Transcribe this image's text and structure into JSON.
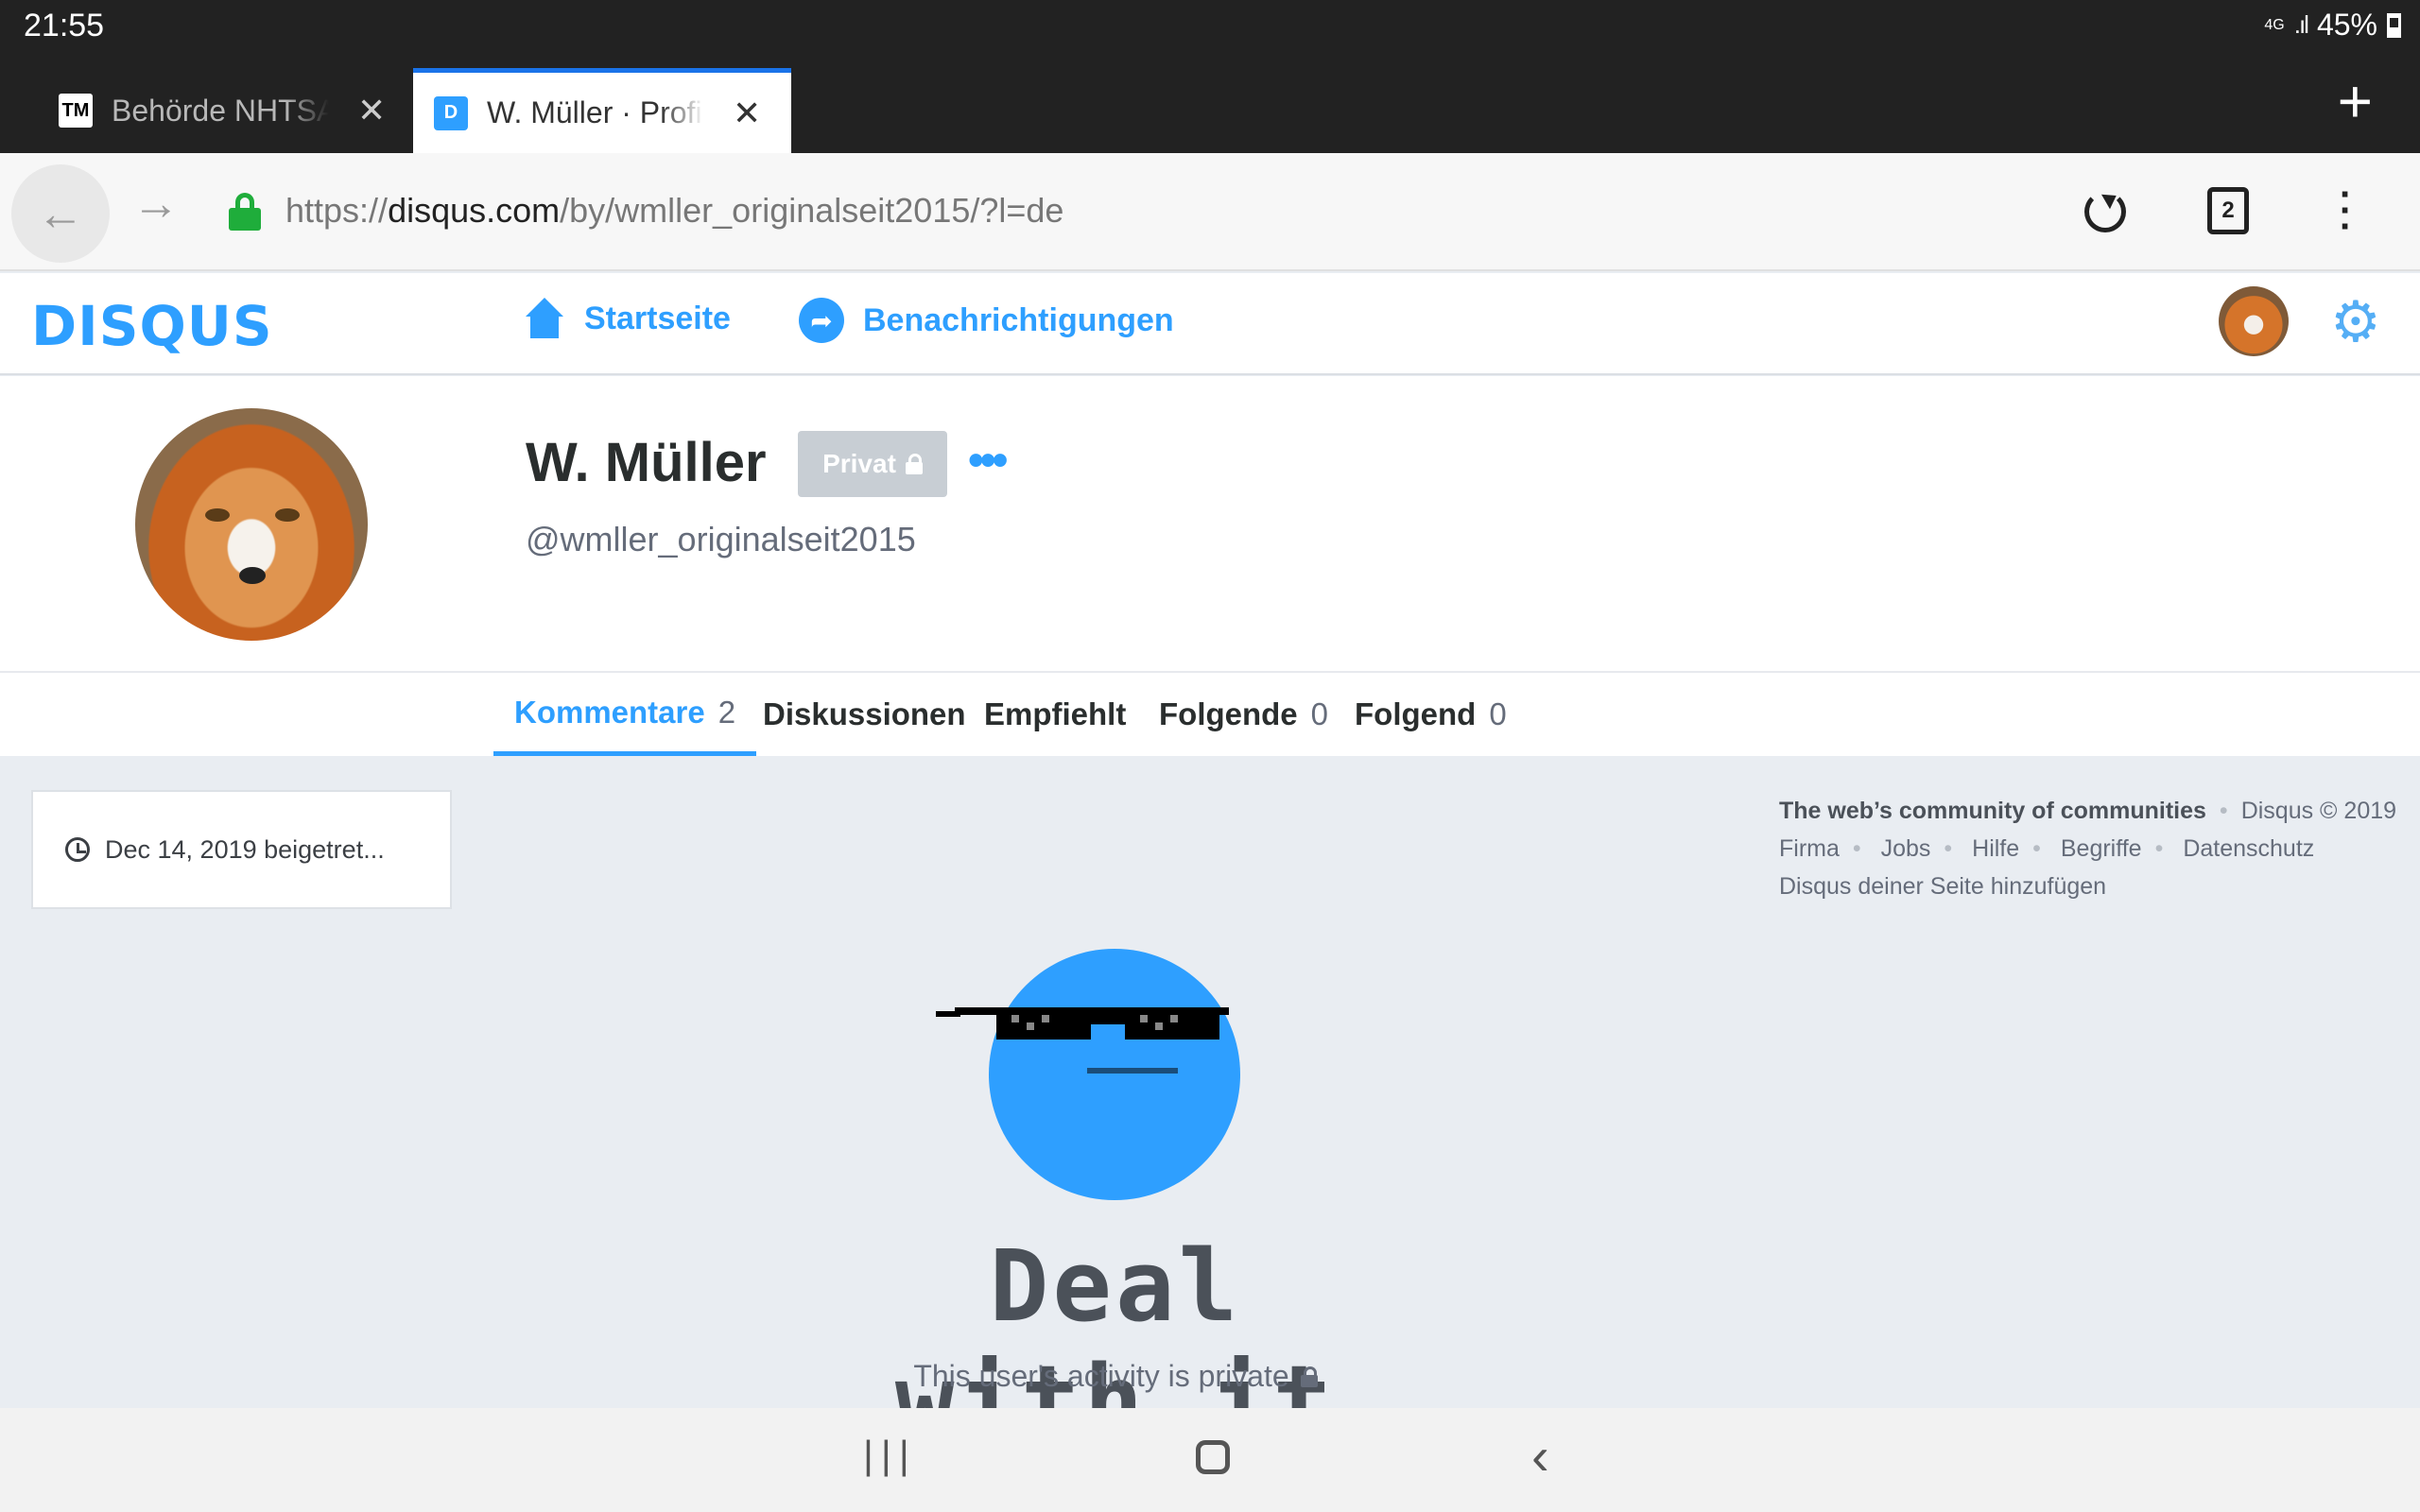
{
  "status_bar": {
    "time": "21:55",
    "network": "4G",
    "battery": "45%"
  },
  "browser": {
    "tabs": [
      {
        "title": "Behörde NHTSA",
        "favicon": "TM"
      },
      {
        "title": "W. Müller · Profil",
        "favicon": "D"
      }
    ],
    "url_prefix": "https://",
    "url_domain": "disqus.com",
    "url_path": "/by/wmller_originalseit2015/?l=de",
    "tab_count": "2"
  },
  "disqus_nav": {
    "logo": "DISQUS",
    "home_label": "Startseite",
    "notifications_label": "Benachrichtigungen"
  },
  "profile": {
    "name": "W. Müller",
    "privacy_badge": "Privat",
    "more_label": "•••",
    "handle": "@wmller_originalseit2015"
  },
  "profile_tabs": [
    {
      "label": "Kommentare",
      "count": "2"
    },
    {
      "label": "Diskussionen",
      "count": ""
    },
    {
      "label": "Empfiehlt",
      "count": ""
    },
    {
      "label": "Folgende",
      "count": "0"
    },
    {
      "label": "Folgend",
      "count": "0"
    }
  ],
  "joined": "Dec 14, 2019 beigetret...",
  "footer": {
    "tagline": "The web’s community of communities",
    "copyright": "Disqus © 2019",
    "links": [
      "Firma",
      "Jobs",
      "Hilfe",
      "Begriffe",
      "Datenschutz"
    ],
    "add_disqus": "Disqus deiner Seite hinzufügen"
  },
  "private_state": {
    "headline": "Deal with it",
    "note": "This user's activity is private"
  },
  "colors": {
    "accent": "#2e9fff",
    "background": "#e9edf2",
    "text": "#2a2e2e"
  }
}
